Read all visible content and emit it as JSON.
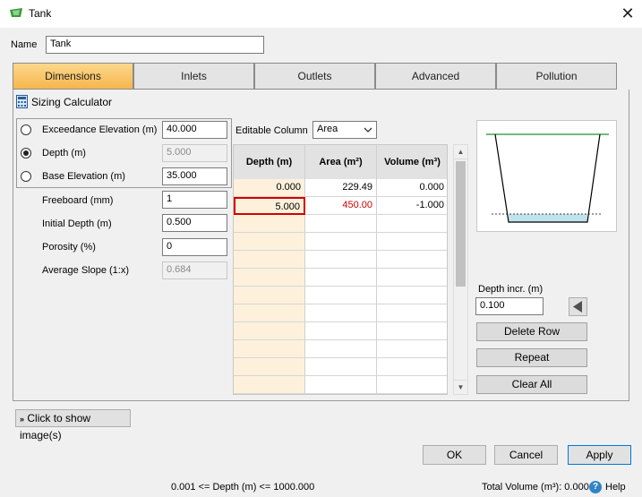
{
  "window": {
    "title": "Tank",
    "close_icon": "close-icon"
  },
  "name_field": {
    "label": "Name",
    "value": "Tank"
  },
  "tabs": [
    {
      "label": "Dimensions",
      "active": true
    },
    {
      "label": "Inlets",
      "active": false
    },
    {
      "label": "Outlets",
      "active": false
    },
    {
      "label": "Advanced",
      "active": false
    },
    {
      "label": "Pollution",
      "active": false
    }
  ],
  "sizing": {
    "label": "Sizing Calculator"
  },
  "params": {
    "exceedance": {
      "label": "Exceedance Elevation (m)",
      "value": "40.000",
      "selected": false
    },
    "depth": {
      "label": "Depth (m)",
      "value": "5.000",
      "selected": true
    },
    "base": {
      "label": "Base Elevation (m)",
      "value": "35.000",
      "selected": false
    },
    "freeboard": {
      "label": "Freeboard (mm)",
      "value": "1"
    },
    "initial_depth": {
      "label": "Initial Depth (m)",
      "value": "0.500"
    },
    "porosity": {
      "label": "Porosity (%)",
      "value": "0"
    },
    "avg_slope": {
      "label": "Average Slope (1:x)",
      "value": "0.684"
    }
  },
  "editable_column": {
    "label": "Editable Column",
    "value": "Area"
  },
  "table": {
    "headers": [
      "Depth (m)",
      "Area (m²)",
      "Volume (m³)"
    ],
    "rows": [
      [
        "0.000",
        "229.49",
        "0.000"
      ],
      [
        "5.000",
        "450.00",
        "-1.000"
      ]
    ]
  },
  "depth_incr": {
    "label": "Depth incr. (m)",
    "value": "0.100"
  },
  "buttons": {
    "delete_row": "Delete Row",
    "repeat": "Repeat",
    "clear_all": "Clear All",
    "show_images": "Click to show image(s)",
    "ok": "OK",
    "cancel": "Cancel",
    "apply": "Apply",
    "help": "Help"
  },
  "status": {
    "range": "0.001 <= Depth (m) <= 1000.000",
    "total_volume": "Total Volume (m³): 0.000"
  },
  "colors": {
    "active_tab": "#f6b64d",
    "error_red": "#d40000",
    "depth_col": "#fdf1dc",
    "water": "#bfe3ec",
    "green_line": "#1f8f2f"
  }
}
